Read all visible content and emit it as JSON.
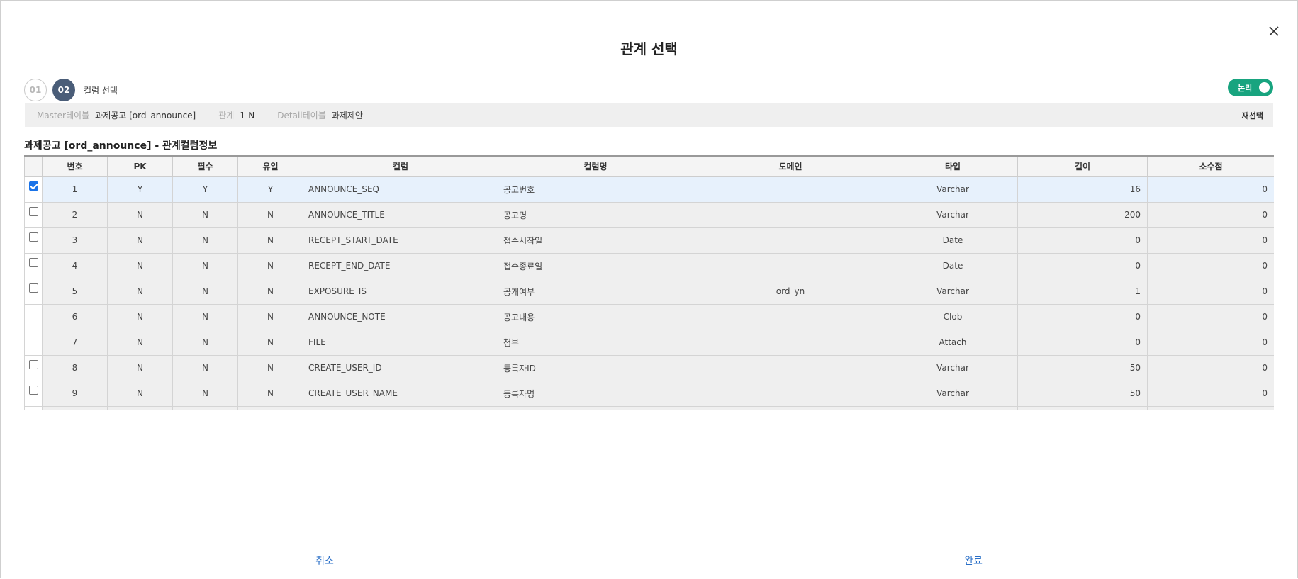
{
  "modal": {
    "title": "관계 선택"
  },
  "steps": [
    {
      "number": "01",
      "active": false
    },
    {
      "number": "02",
      "active": true,
      "label": "컬럼 선택"
    }
  ],
  "toggle": {
    "label": "논리",
    "on": true,
    "color": "#18a47f"
  },
  "info": {
    "master_label": "Master테이블",
    "master_value": "과제공고 [ord_announce]",
    "relation_label": "관계",
    "relation_value": "1-N",
    "detail_label": "Detail테이블",
    "detail_value": "과제제안",
    "reselect_label": "재선택"
  },
  "section_title": "과제공고 [ord_announce] - 관계컬럼정보",
  "table": {
    "headers": [
      "번호",
      "PK",
      "필수",
      "유일",
      "컬럼",
      "컬럼명",
      "도메인",
      "타입",
      "길이",
      "소수점"
    ],
    "rows": [
      {
        "checkbox": true,
        "checked": true,
        "no": "1",
        "pk": "Y",
        "req": "Y",
        "uniq": "Y",
        "column": "ANNOUNCE_SEQ",
        "name": "공고번호",
        "domain": "",
        "type": "Varchar",
        "length": "16",
        "scale": "0"
      },
      {
        "checkbox": true,
        "checked": false,
        "no": "2",
        "pk": "N",
        "req": "N",
        "uniq": "N",
        "column": "ANNOUNCE_TITLE",
        "name": "공고명",
        "domain": "",
        "type": "Varchar",
        "length": "200",
        "scale": "0"
      },
      {
        "checkbox": true,
        "checked": false,
        "no": "3",
        "pk": "N",
        "req": "N",
        "uniq": "N",
        "column": "RECEPT_START_DATE",
        "name": "접수시작일",
        "domain": "",
        "type": "Date",
        "length": "0",
        "scale": "0"
      },
      {
        "checkbox": true,
        "checked": false,
        "no": "4",
        "pk": "N",
        "req": "N",
        "uniq": "N",
        "column": "RECEPT_END_DATE",
        "name": "접수종료일",
        "domain": "",
        "type": "Date",
        "length": "0",
        "scale": "0"
      },
      {
        "checkbox": true,
        "checked": false,
        "no": "5",
        "pk": "N",
        "req": "N",
        "uniq": "N",
        "column": "EXPOSURE_IS",
        "name": "공개여부",
        "domain": "ord_yn",
        "type": "Varchar",
        "length": "1",
        "scale": "0"
      },
      {
        "checkbox": false,
        "checked": false,
        "no": "6",
        "pk": "N",
        "req": "N",
        "uniq": "N",
        "column": "ANNOUNCE_NOTE",
        "name": "공고내용",
        "domain": "",
        "type": "Clob",
        "length": "0",
        "scale": "0"
      },
      {
        "checkbox": false,
        "checked": false,
        "no": "7",
        "pk": "N",
        "req": "N",
        "uniq": "N",
        "column": "FILE",
        "name": "첨부",
        "domain": "",
        "type": "Attach",
        "length": "0",
        "scale": "0"
      },
      {
        "checkbox": true,
        "checked": false,
        "no": "8",
        "pk": "N",
        "req": "N",
        "uniq": "N",
        "column": "CREATE_USER_ID",
        "name": "등록자ID",
        "domain": "",
        "type": "Varchar",
        "length": "50",
        "scale": "0"
      },
      {
        "checkbox": true,
        "checked": false,
        "no": "9",
        "pk": "N",
        "req": "N",
        "uniq": "N",
        "column": "CREATE_USER_NAME",
        "name": "등록자명",
        "domain": "",
        "type": "Varchar",
        "length": "50",
        "scale": "0"
      },
      {
        "checkbox": false,
        "checked": false,
        "no": "",
        "pk": "",
        "req": "",
        "uniq": "",
        "column": "",
        "name": "",
        "domain": "",
        "type": "",
        "length": "",
        "scale": ""
      }
    ]
  },
  "footer": {
    "cancel_label": "취소",
    "done_label": "완료"
  }
}
